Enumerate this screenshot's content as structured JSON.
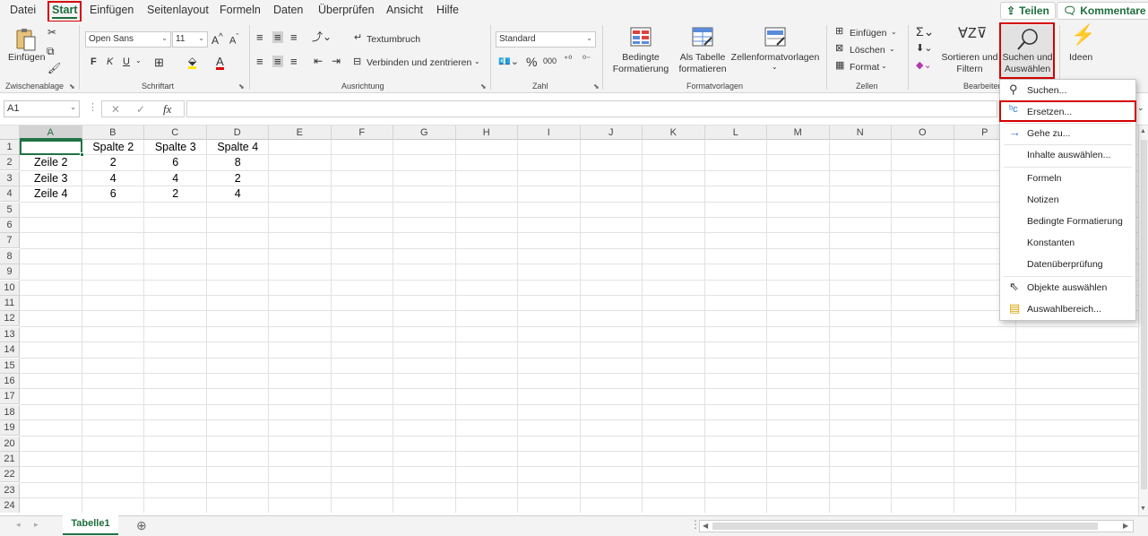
{
  "tabs": [
    "Datei",
    "Start",
    "Einfügen",
    "Seitenlayout",
    "Formeln",
    "Daten",
    "Überprüfen",
    "Ansicht",
    "Hilfe"
  ],
  "share_label": "Teilen",
  "comments_label": "Kommentare",
  "clipboard": {
    "paste_label": "Einfügen",
    "group_label": "Zwischenablage"
  },
  "font": {
    "name": "Open Sans",
    "size": "11",
    "bold": "F",
    "italic": "K",
    "underline": "U",
    "group_label": "Schriftart"
  },
  "alignment": {
    "wrap_label": "Textumbruch",
    "merge_label": "Verbinden und zentrieren",
    "group_label": "Ausrichtung"
  },
  "number": {
    "format": "Standard",
    "percent": "%",
    "thousands": "000",
    "group_label": "Zahl"
  },
  "styles": {
    "conditional_l1": "Bedingte",
    "conditional_l2": "Formatierung",
    "table_l1": "Als Tabelle",
    "table_l2": "formatieren",
    "cellstyles_label": "Zellenformatvorlagen",
    "group_label": "Formatvorlagen"
  },
  "cells": {
    "insert_label": "Einfügen",
    "delete_label": "Löschen",
    "format_label": "Format",
    "group_label": "Zellen"
  },
  "editing": {
    "sort_l1": "Sortieren und",
    "sort_l2": "Filtern",
    "find_l1": "Suchen und",
    "find_l2": "Auswählen",
    "group_label": "Bearbeiten"
  },
  "ideas_label": "Ideen",
  "namebox": "A1",
  "fx_label": "fx",
  "columns": [
    "A",
    "B",
    "C",
    "D",
    "E",
    "F",
    "G",
    "H",
    "I",
    "J",
    "K",
    "L",
    "M",
    "N",
    "O",
    "P"
  ],
  "rows": [
    "1",
    "2",
    "3",
    "4",
    "5",
    "6",
    "7",
    "8",
    "9",
    "10",
    "11",
    "12",
    "13",
    "14",
    "15",
    "16",
    "17",
    "18",
    "19",
    "20",
    "21",
    "22",
    "23",
    "24"
  ],
  "table": [
    [
      "",
      "Spalte 2",
      "Spalte 3",
      "Spalte 4"
    ],
    [
      "Zeile 2",
      "2",
      "6",
      "8"
    ],
    [
      "Zeile 3",
      "4",
      "4",
      "2"
    ],
    [
      "Zeile 4",
      "6",
      "2",
      "4"
    ]
  ],
  "sheet_tab": "Tabelle1",
  "menu_items": [
    "Suchen...",
    "Ersetzen...",
    "Gehe zu...",
    "Inhalte auswählen...",
    "Formeln",
    "Notizen",
    "Bedingte Formatierung",
    "Konstanten",
    "Datenüberprüfung",
    "Objekte auswählen",
    "Auswahlbereich..."
  ],
  "colors": {
    "accent": "#217346",
    "highlight": "#d40000"
  }
}
